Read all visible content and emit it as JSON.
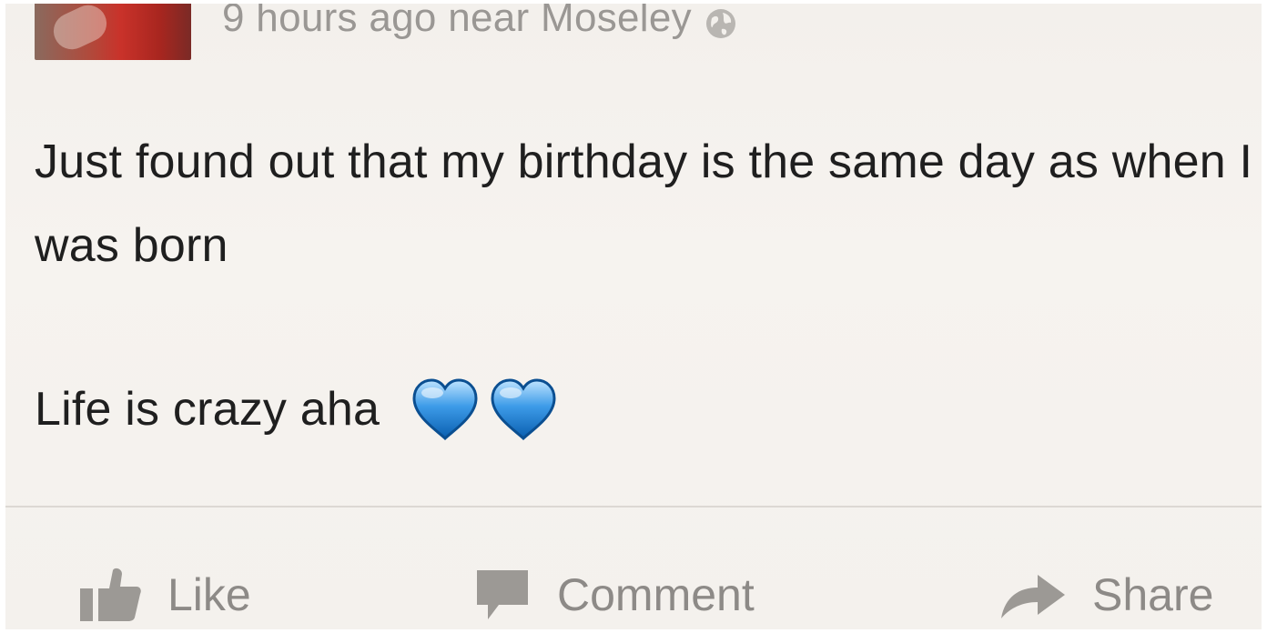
{
  "post": {
    "meta": {
      "time_location": "9 hours ago near Moseley",
      "privacy_icon": "globe-icon"
    },
    "body": {
      "line1": "Just found out that my birthday is the same day as when I was born",
      "line2": "Life is crazy aha",
      "emoji": [
        "blue-heart-icon",
        "blue-heart-icon"
      ]
    },
    "actions": [
      {
        "label": "Like",
        "icon": "thumbs-up-icon"
      },
      {
        "label": "Comment",
        "icon": "comment-icon"
      },
      {
        "label": "Share",
        "icon": "share-arrow-icon"
      }
    ]
  },
  "colors": {
    "background": "#f4f1ed",
    "text": "#1f1f1f",
    "muted": "#8d8a87",
    "heart_blue": "#2f8fe0"
  }
}
